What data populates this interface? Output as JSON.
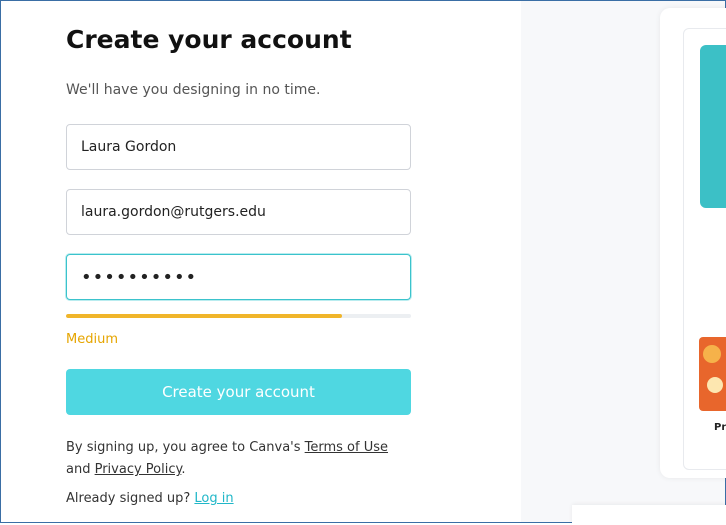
{
  "form": {
    "title": "Create your account",
    "subtitle": "We'll have you designing in no time.",
    "name_value": "Laura Gordon",
    "email_value": "laura.gordon@rutgers.edu",
    "password_value": "••••••••••",
    "strength": {
      "label": "Medium",
      "fraction": 0.8,
      "color": "#f0b52a"
    },
    "submit_label": "Create your account",
    "terms": {
      "prefix": "By signing up, you agree to Canva's ",
      "terms_link": "Terms of Use",
      "middle": "and ",
      "privacy_link": "Privacy Policy",
      "suffix": "."
    },
    "login": {
      "prefix": "Already signed up? ",
      "link": "Log in"
    }
  },
  "preview": {
    "thumb_label": "Pr"
  },
  "colors": {
    "accent": "#4fd7e1",
    "link": "#20b7c8",
    "warning": "#e6a500"
  }
}
